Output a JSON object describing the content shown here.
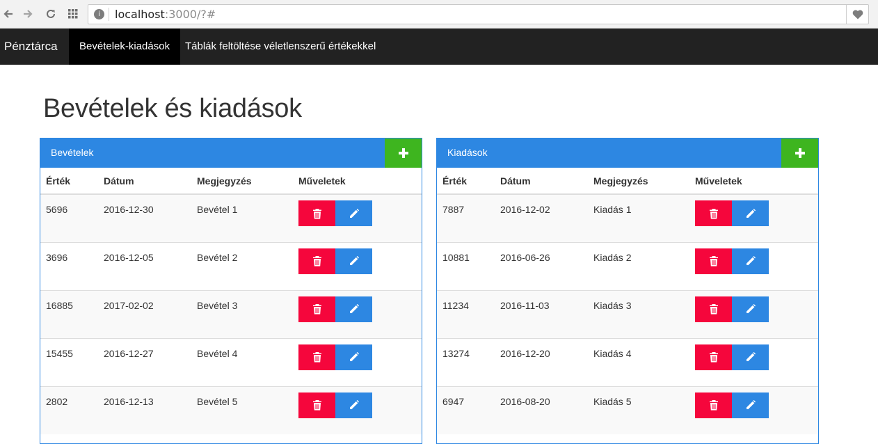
{
  "browser": {
    "url_host": "localhost",
    "url_rest": ":3000/?#",
    "info_glyph": "i"
  },
  "navbar": {
    "brand": "Pénztárca",
    "items": [
      {
        "label": "Bevételek-kiadások",
        "active": true
      },
      {
        "label": "Táblák feltöltése véletlenszerű értékekkel",
        "active": false
      }
    ]
  },
  "page": {
    "title": "Bevételek és kiadások"
  },
  "columns": [
    "Érték",
    "Dátum",
    "Megjegyzés",
    "Műveletek"
  ],
  "income": {
    "title": "Bevételek",
    "rows": [
      {
        "value": "5696",
        "date": "2016-12-30",
        "note": "Bevétel 1"
      },
      {
        "value": "3696",
        "date": "2016-12-05",
        "note": "Bevétel 2"
      },
      {
        "value": "16885",
        "date": "2017-02-02",
        "note": "Bevétel 3"
      },
      {
        "value": "15455",
        "date": "2016-12-27",
        "note": "Bevétel 4"
      },
      {
        "value": "2802",
        "date": "2016-12-13",
        "note": "Bevétel 5"
      }
    ]
  },
  "expense": {
    "title": "Kiadások",
    "rows": [
      {
        "value": "7887",
        "date": "2016-12-02",
        "note": "Kiadás 1"
      },
      {
        "value": "10881",
        "date": "2016-06-26",
        "note": "Kiadás 2"
      },
      {
        "value": "11234",
        "date": "2016-11-03",
        "note": "Kiadás 3"
      },
      {
        "value": "13274",
        "date": "2016-12-20",
        "note": "Kiadás 4"
      },
      {
        "value": "6947",
        "date": "2016-08-20",
        "note": "Kiadás 5"
      }
    ]
  },
  "colors": {
    "navbar": "#222222",
    "panel_header": "#2d87e2",
    "add_button": "#3eb51f",
    "delete_button": "#f5063c",
    "edit_button": "#2d87e2"
  },
  "icons": {
    "back": "arrow-left-icon",
    "forward": "arrow-right-icon",
    "reload": "reload-icon",
    "apps": "apps-grid-icon",
    "info": "info-icon",
    "favorite": "heart-icon",
    "add": "plus-icon",
    "delete": "trash-icon",
    "edit": "pencil-icon"
  }
}
